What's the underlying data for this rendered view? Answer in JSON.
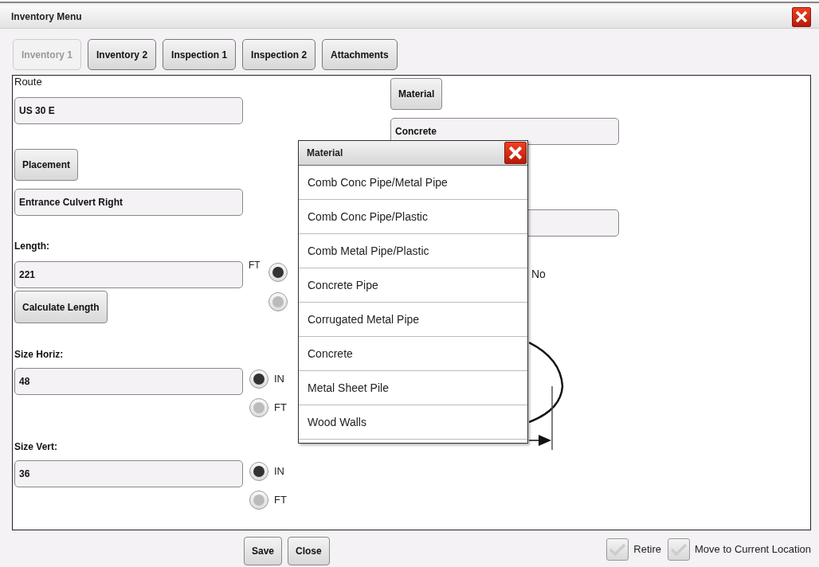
{
  "window": {
    "title": "Inventory Menu"
  },
  "tabs": [
    {
      "label": "Inventory 1",
      "selected": true
    },
    {
      "label": "Inventory 2",
      "selected": false
    },
    {
      "label": "Inspection 1",
      "selected": false
    },
    {
      "label": "Inspection 2",
      "selected": false
    },
    {
      "label": "Attachments",
      "selected": false
    }
  ],
  "route": {
    "label": "Route",
    "value": "US 30 E"
  },
  "placement": {
    "button": "Placement",
    "value": "Entrance Culvert Right"
  },
  "length": {
    "label": "Length:",
    "value": "221",
    "unit_label": "FT",
    "button": "Calculate Length",
    "radios": [
      {
        "selected": true
      },
      {
        "selected": false
      }
    ]
  },
  "size_horiz": {
    "label": "Size Horiz:",
    "value": "48",
    "radios": [
      {
        "label": "IN",
        "selected": true
      },
      {
        "label": "FT",
        "selected": false
      }
    ]
  },
  "size_vert": {
    "label": "Size Vert:",
    "value": "36",
    "radios": [
      {
        "label": "IN",
        "selected": true
      },
      {
        "label": "FT",
        "selected": false
      }
    ]
  },
  "material": {
    "button": "Material",
    "value": "Concrete"
  },
  "radio_label": "No",
  "popup": {
    "title": "Material",
    "options": [
      "Comb Conc Pipe/Metal Pipe",
      "Comb Conc Pipe/Plastic",
      "Comb Metal Pipe/Plastic",
      "Concrete Pipe",
      "Corrugated Metal Pipe",
      "Concrete",
      "Metal Sheet Pile",
      "Wood Walls"
    ]
  },
  "buttons": [
    "Save",
    "Close"
  ],
  "checkboxes": [
    {
      "label": "Retire",
      "checked": false
    },
    {
      "label": "Move to Current Location",
      "checked": false
    }
  ]
}
